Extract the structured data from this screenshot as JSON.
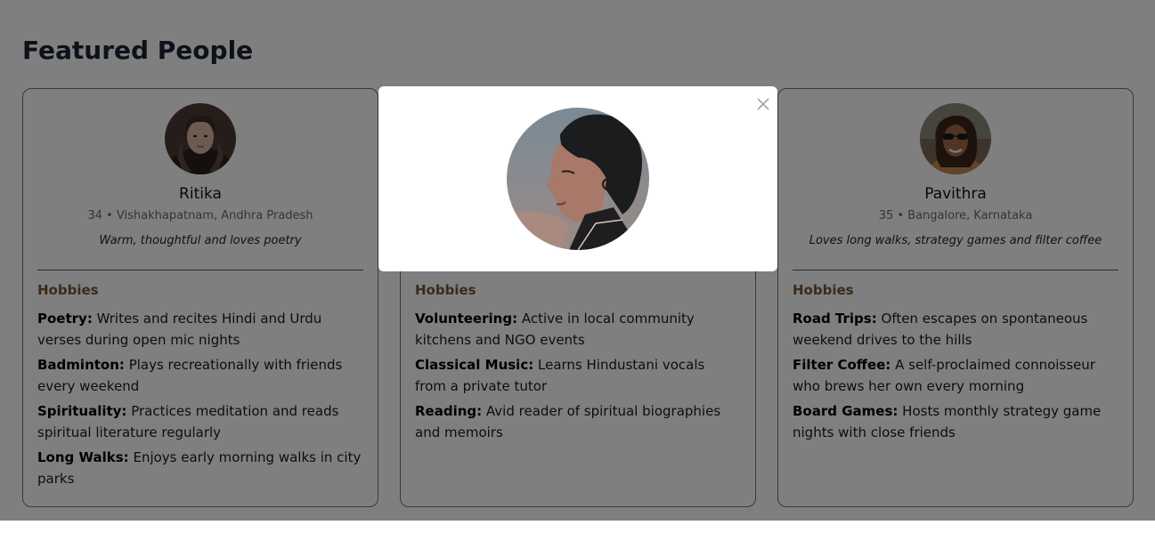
{
  "page": {
    "title": "Featured People"
  },
  "cards": [
    {
      "name": "Ritika",
      "meta": "34 • Vishakhapatnam, Andhra Pradesh",
      "tagline": "Warm, thoughtful and loves poetry",
      "hobbies_heading": "Hobbies",
      "hobbies": [
        {
          "title": "Poetry:",
          "desc": "Writes and recites Hindi and Urdu verses during open mic nights"
        },
        {
          "title": "Badminton:",
          "desc": "Plays recreationally with friends every weekend"
        },
        {
          "title": "Spirituality:",
          "desc": "Practices meditation and reads spiritual literature regularly"
        },
        {
          "title": "Long Walks:",
          "desc": "Enjoys early morning walks in city parks"
        }
      ]
    },
    {
      "name": "",
      "meta": "",
      "tagline": "",
      "hobbies_heading": "Hobbies",
      "hobbies": [
        {
          "title": "Volunteering:",
          "desc": "Active in local community kitchens and NGO events"
        },
        {
          "title": "Classical Music:",
          "desc": "Learns Hindustani vocals from a private tutor"
        },
        {
          "title": "Reading:",
          "desc": "Avid reader of spiritual biographies and memoirs"
        }
      ]
    },
    {
      "name": "Pavithra",
      "meta": "35 • Bangalore, Karnataka",
      "tagline": "Loves long walks, strategy games and filter coffee",
      "hobbies_heading": "Hobbies",
      "hobbies": [
        {
          "title": "Road Trips:",
          "desc": "Often escapes on spontaneous weekend drives to the hills"
        },
        {
          "title": "Filter Coffee:",
          "desc": "A self-proclaimed connoisseur who brews her own every morning"
        },
        {
          "title": "Board Games:",
          "desc": "Hosts monthly strategy game nights with close friends"
        }
      ]
    }
  ],
  "modal": {
    "close_icon": "close-icon"
  },
  "colors": {
    "overlay": "rgba(0,0,0,0.5)",
    "card_border": "#8a6a55",
    "hobbies_heading": "#7a5232",
    "title": "#1a2233"
  }
}
